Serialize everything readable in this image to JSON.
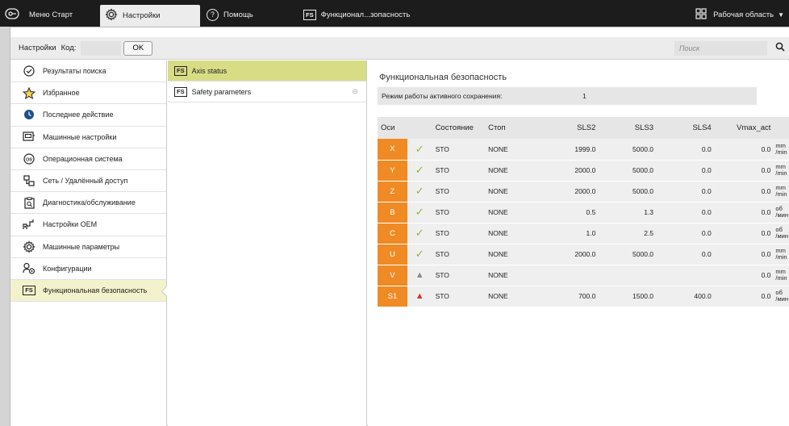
{
  "tabs": [
    {
      "label": "Меню Старт",
      "icon": "start-menu-icon"
    },
    {
      "label": "Настройки",
      "icon": "gear-icon"
    },
    {
      "label": "Помощь",
      "icon": "help-icon"
    },
    {
      "label": "Функционал...зопасность",
      "icon": "fs-icon"
    }
  ],
  "workspace": {
    "label": "Рабочая область",
    "icon": "workspace-grid-icon"
  },
  "toolbar": {
    "settings_label": "Настройки",
    "code_label": "Код:",
    "code_value": "",
    "ok_label": "OK",
    "search_placeholder": "Поиск"
  },
  "fs_badge": "FS",
  "nav": {
    "items": [
      {
        "label": "Результаты поиска",
        "icon": "check-circle-icon"
      },
      {
        "label": "Избранное",
        "icon": "star-icon"
      },
      {
        "label": "Последнее действие",
        "icon": "clock-icon"
      },
      {
        "label": "Машинные настройки",
        "icon": "machine-settings-icon"
      },
      {
        "label": "Операционная система",
        "icon": "os-icon"
      },
      {
        "label": "Сеть / Удалённый доступ",
        "icon": "network-icon"
      },
      {
        "label": "Диагностика/обслуживание",
        "icon": "diagnostics-icon"
      },
      {
        "label": "Настройки OEM",
        "icon": "oem-icon"
      },
      {
        "label": "Машинные параметры",
        "icon": "gear-icon"
      },
      {
        "label": "Конфигурации",
        "icon": "config-icon"
      },
      {
        "label": "Функциональная безопасность",
        "icon": "fs-icon"
      }
    ]
  },
  "sub": {
    "items": [
      {
        "label": "Axis status"
      },
      {
        "label": "Safety parameters"
      }
    ]
  },
  "content": {
    "title": "Функциональная безопасность",
    "mode_label": "Режим работы активного сохранения:",
    "mode_value": "1",
    "headers": [
      "Оси",
      "",
      "Состояние",
      "Стоп",
      "SLS2",
      "SLS3",
      "SLS4",
      "Vmax_act",
      ""
    ],
    "rows": [
      {
        "axis": "X",
        "status": "ok",
        "state": "STO",
        "stop": "NONE",
        "sls2": "1999.0",
        "sls3": "5000.0",
        "sls4": "0.0",
        "vmax": "0.0",
        "u1": "mm",
        "u2": "/min"
      },
      {
        "axis": "Y",
        "status": "ok",
        "state": "STO",
        "stop": "NONE",
        "sls2": "2000.0",
        "sls3": "5000.0",
        "sls4": "0.0",
        "vmax": "0.0",
        "u1": "mm",
        "u2": "/min"
      },
      {
        "axis": "Z",
        "status": "ok",
        "state": "STO",
        "stop": "NONE",
        "sls2": "2000.0",
        "sls3": "5000.0",
        "sls4": "0.0",
        "vmax": "0.0",
        "u1": "mm",
        "u2": "/min"
      },
      {
        "axis": "B",
        "status": "ok",
        "state": "STO",
        "stop": "NONE",
        "sls2": "0.5",
        "sls3": "1.3",
        "sls4": "0.0",
        "vmax": "0.0",
        "u1": "об",
        "u2": "/мин"
      },
      {
        "axis": "C",
        "status": "ok",
        "state": "STO",
        "stop": "NONE",
        "sls2": "1.0",
        "sls3": "2.5",
        "sls4": "0.0",
        "vmax": "0.0",
        "u1": "об",
        "u2": "/мин"
      },
      {
        "axis": "U",
        "status": "ok",
        "state": "STO",
        "stop": "NONE",
        "sls2": "2000.0",
        "sls3": "5000.0",
        "sls4": "0.0",
        "vmax": "0.0",
        "u1": "mm",
        "u2": "/min"
      },
      {
        "axis": "V",
        "status": "warn-grey",
        "state": "STO",
        "stop": "NONE",
        "sls2": "",
        "sls3": "",
        "sls4": "",
        "vmax": "0.0",
        "u1": "mm",
        "u2": "/min"
      },
      {
        "axis": "S1",
        "status": "warn-red",
        "state": "STO",
        "stop": "NONE",
        "sls2": "700.0",
        "sls3": "1500.0",
        "sls4": "400.0",
        "vmax": "0.0",
        "u1": "об",
        "u2": "/мин"
      }
    ]
  },
  "colors": {
    "axis_orange": "#f08a24",
    "active_sub": "#d8dc84",
    "active_nav": "#f4f2cc",
    "ok_green": "#8db33a",
    "warn_red": "#d9352b"
  }
}
